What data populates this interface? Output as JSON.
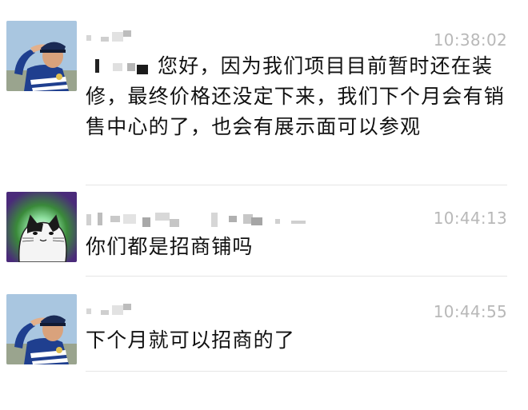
{
  "messages": [
    {
      "avatar": "officer-salute-photo",
      "sender": "",
      "time": "10:38:02",
      "text": "您好，因为我们项目目前暂时还在装修，最终价格还没定下来，我们下个月会有销售中心的了，也会有展示面可以参观"
    },
    {
      "avatar": "cartoon-cat",
      "sender": "",
      "time": "10:44:13",
      "text": "你们都是招商铺吗"
    },
    {
      "avatar": "officer-salute-photo",
      "sender": "",
      "time": "10:44:55",
      "text": "下个月就可以招商的了"
    }
  ],
  "colors": {
    "text": "#111111",
    "time": "#b8b8b8",
    "divider": "#e6e6e6"
  }
}
